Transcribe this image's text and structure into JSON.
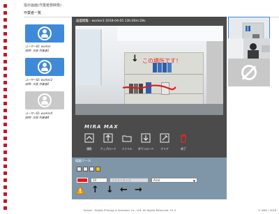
{
  "app_title": "指示画面(作業者側映像)",
  "section_title": "作業者一覧",
  "workers": [
    {
      "id_line": "ユーザーID: worker",
      "name_line": "説明: 大阪 作業者1",
      "status": "online"
    },
    {
      "id_line": "ユーザーID: worker2",
      "name_line": "説明: 大阪 作業者2",
      "status": "online"
    },
    {
      "id_line": "ユーザーID: worker4",
      "name_line": "説明: 大阪 作業者4",
      "status": "offline"
    }
  ],
  "video": {
    "header": "画面閲覧 - worker2 2018-04-05 13h:00m:28s",
    "annotation_text": "この場所です！",
    "logo": "MIRA MAX"
  },
  "toolbar": {
    "items": [
      {
        "label": "撮影",
        "icon": "capture-icon"
      },
      {
        "label": "アップロード",
        "icon": "upload-icon"
      },
      {
        "label": "ファイル",
        "icon": "folder-icon"
      },
      {
        "label": "ダウンロード",
        "icon": "download-icon"
      },
      {
        "label": "クリア",
        "icon": "clear-icon"
      },
      {
        "label": "終了",
        "icon": "trash-icon"
      }
    ]
  },
  "drawing": {
    "title": "描画ツール",
    "color_hex": "#e21a1a",
    "stroke_value": "10",
    "text_placeholder": "テキストを入力",
    "font_value": "Arial"
  },
  "footer": {
    "copyright": "Kanae · Digital Printing & Solutions Co., Ltd. All Rights Reserved. V1.0",
    "right_text": "© KAN / 2018"
  },
  "colors": {
    "brand_red": "#c4162a",
    "online_blue": "#3f8ad8",
    "panel_dark": "#4b4b4b",
    "tool_panel": "#7f96a8"
  }
}
